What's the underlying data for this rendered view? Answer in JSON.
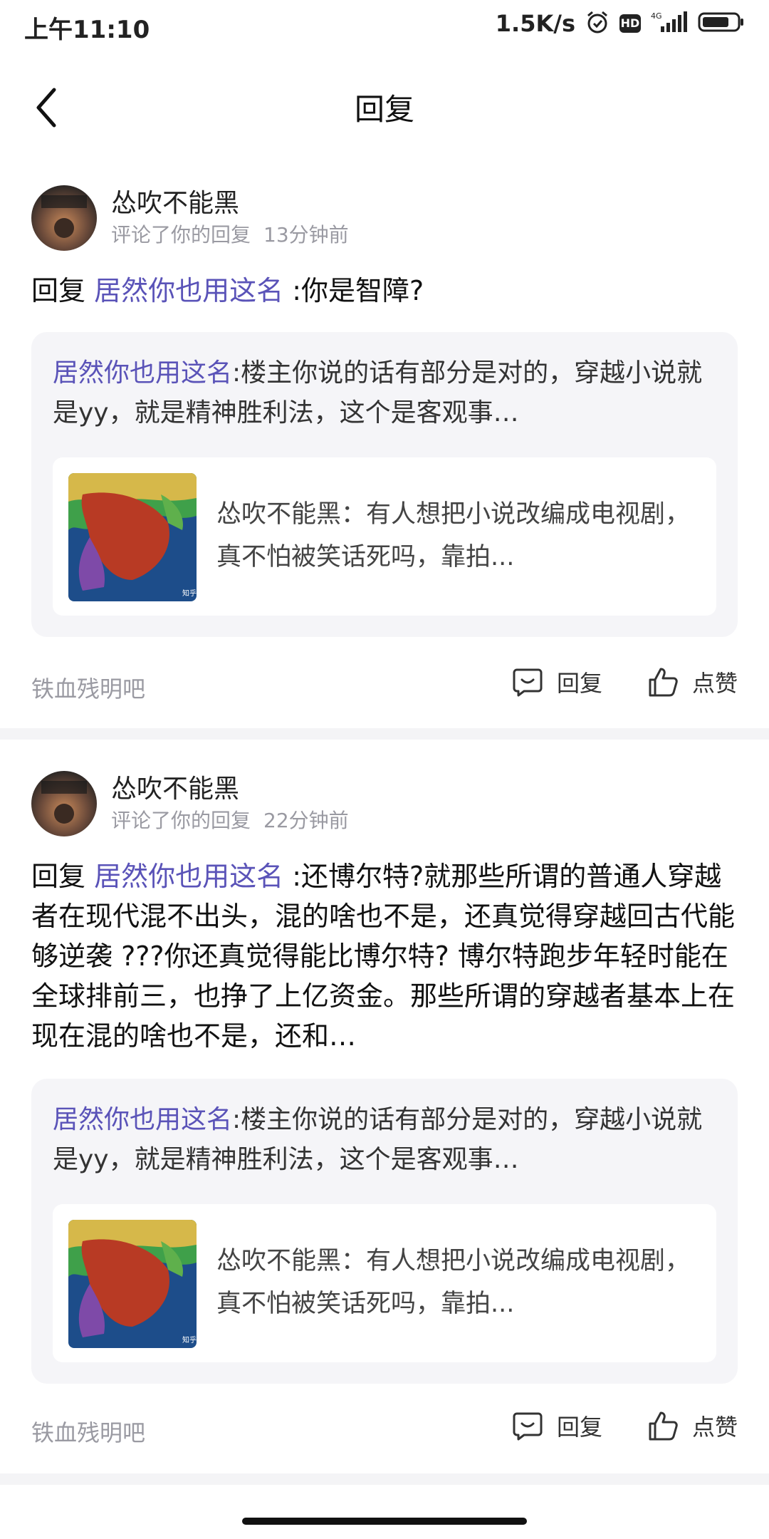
{
  "status_bar": {
    "time": "上午11:10",
    "net_speed": "1.5K/s",
    "hd": "HD",
    "network": "4G"
  },
  "header": {
    "title": "回复"
  },
  "cards": [
    {
      "username": "怂吹不能黑",
      "action_text": "评论了你的回复",
      "time_ago": "13分钟前",
      "reply_prefix": "回复",
      "mention": "居然你也用这名",
      "reply_body": ":你是智障?",
      "quote_author": "居然你也用这名",
      "quote_body": ":楼主你说的话有部分是对的，穿越小说就是yy，就是精神胜利法，这个是客观事…",
      "inner_text": "怂吹不能黑：有人想把小说改编成电视剧，真不怕被笑话死吗，靠拍...",
      "thumb_watermark": "知乎",
      "forum": "铁血残明吧",
      "reply_label": "回复",
      "like_label": "点赞"
    },
    {
      "username": "怂吹不能黑",
      "action_text": "评论了你的回复",
      "time_ago": "22分钟前",
      "reply_prefix": "回复",
      "mention": "居然你也用这名",
      "reply_body": ":还博尔特?就那些所谓的普通人穿越者在现代混不出头，混的啥也不是，还真觉得穿越回古代能够逆袭 ???你还真觉得能比博尔特? 博尔特跑步年轻时能在全球排前三，也挣了上亿资金。那些所谓的穿越者基本上在现在混的啥也不是，还和…",
      "quote_author": "居然你也用这名",
      "quote_body": ":楼主你说的话有部分是对的，穿越小说就是yy，就是精神胜利法，这个是客观事…",
      "inner_text": "怂吹不能黑：有人想把小说改编成电视剧，真不怕被笑话死吗，靠拍...",
      "thumb_watermark": "知乎",
      "forum": "铁血残明吧",
      "reply_label": "回复",
      "like_label": "点赞"
    }
  ],
  "colors": {
    "mention": "#5a53b8",
    "meta": "#9a9aa2",
    "quote_bg": "#f5f5f8"
  }
}
